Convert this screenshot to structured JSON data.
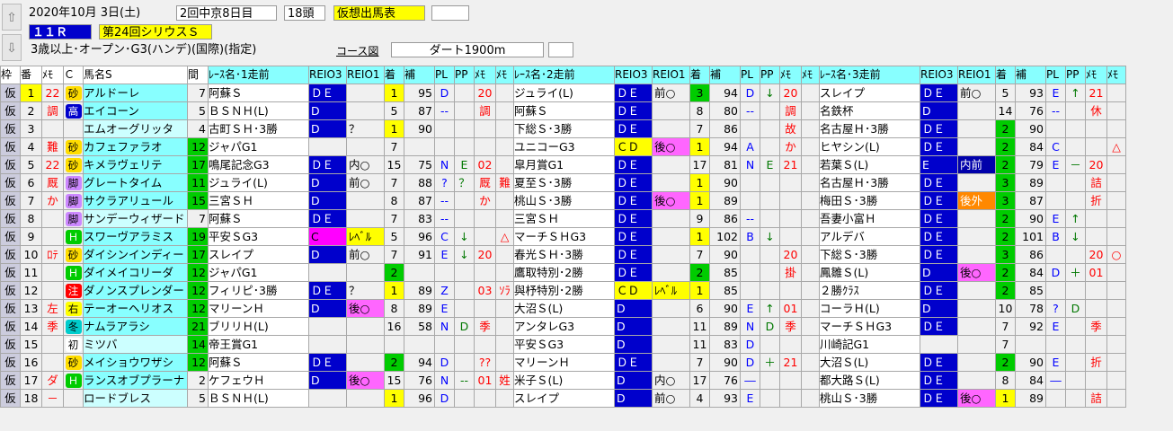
{
  "header": {
    "date": "2020年10月 3日(土)",
    "meet": "2回中京8日目",
    "count": "18頭",
    "status": "仮想出馬表",
    "race_no": "１１Ｒ",
    "race_name": "第24回シリウスＳ",
    "conditions": "3歳以上･オープン･G3(ハンデ)(国際)(指定)",
    "course_label": "コース図",
    "course": "ダート1900m"
  },
  "columns": [
    "枠",
    "番",
    "ﾒﾓ",
    "Ｃ",
    "馬名S",
    "間",
    "ﾚｰｽ名･1走前",
    "REIO3",
    "REIO1",
    "着",
    "補",
    "PL",
    "PP",
    "ﾒﾓ",
    "ﾒﾓ",
    "ﾚｰｽ名･2走前",
    "REIO3",
    "REIO1",
    "着",
    "補",
    "PL",
    "PP",
    "ﾒﾓ",
    "ﾒﾓ",
    "ﾚｰｽ名･3走前",
    "REIO3",
    "REIO1",
    "着",
    "補",
    "PL",
    "PP",
    "ﾒﾓ",
    "ﾒﾓ"
  ],
  "rows": [
    {
      "waku": "仮",
      "ban": "1",
      "memo": "22",
      "c": "砂",
      "name": "アルドーレ",
      "kan": "7",
      "r1": [
        "阿蘇Ｓ",
        "ＤＥ",
        "",
        "1",
        "95",
        "D",
        "",
        "20",
        ""
      ],
      "r2": [
        "ジュライ(L)",
        "ＤＥ",
        "前○",
        "3",
        "94",
        "D",
        "↓",
        "20",
        ""
      ],
      "r3": [
        "スレイプ",
        "ＤＥ",
        "前○",
        "5",
        "93",
        "E",
        "↑",
        "21",
        ""
      ]
    },
    {
      "waku": "仮",
      "ban": "2",
      "memo": "調",
      "c": "高",
      "name": "エイコーン",
      "kan": "5",
      "r1": [
        "ＢＳＮＨ(L)",
        "D",
        "",
        "5",
        "87",
        "--",
        "",
        "調",
        ""
      ],
      "r2": [
        "阿蘇Ｓ",
        "ＤＥ",
        "",
        "8",
        "80",
        "--",
        "",
        "調",
        ""
      ],
      "r3": [
        "名鉄杯",
        "D",
        "",
        "14",
        "76",
        "--",
        "",
        "休",
        ""
      ]
    },
    {
      "waku": "仮",
      "ban": "3",
      "memo": "",
      "c": "",
      "name": "エムオーグリッタ",
      "kan": "4",
      "r1": [
        "古町ＳＨ･3勝",
        "D",
        "？",
        "1",
        "90",
        "",
        "",
        "",
        ""
      ],
      "r2": [
        "下総Ｓ･3勝",
        "ＤＥ",
        "",
        "7",
        "86",
        "",
        "",
        "故",
        ""
      ],
      "r3": [
        "名古屋Ｈ･3勝",
        "ＤＥ",
        "",
        "2",
        "90",
        "",
        "",
        "",
        ""
      ]
    },
    {
      "waku": "仮",
      "ban": "4",
      "memo": "難",
      "c": "砂",
      "name": "カフェファラオ",
      "kan": "12",
      "r1": [
        "ジャパG1",
        "",
        "",
        "7",
        "",
        "",
        "",
        "",
        ""
      ],
      "r2": [
        "ユニコーG3",
        "ＣＤ",
        "後○",
        "1",
        "94",
        "A",
        "",
        "か",
        ""
      ],
      "r3": [
        "ヒヤシン(L)",
        "ＤＥ",
        "",
        "2",
        "84",
        "C",
        "",
        "",
        "△"
      ]
    },
    {
      "waku": "仮",
      "ban": "5",
      "memo": "22",
      "c": "砂",
      "name": "キメラヴェリテ",
      "kan": "17",
      "r1": [
        "鳴尾記念G3",
        "ＤＥ",
        "内○",
        "15",
        "75",
        "N",
        "E",
        "02",
        ""
      ],
      "r2": [
        "皐月賞G1",
        "ＤＥ",
        "",
        "17",
        "81",
        "N",
        "E",
        "21",
        ""
      ],
      "r3": [
        "若葉Ｓ(L)",
        "E",
        "内前",
        "2",
        "79",
        "E",
        "－",
        "20",
        ""
      ]
    },
    {
      "waku": "仮",
      "ban": "6",
      "memo": "厩",
      "c": "脚",
      "name": "グレートタイム",
      "kan": "11",
      "r1": [
        "ジュライ(L)",
        "D",
        "前○",
        "7",
        "88",
        "?",
        "？",
        "厩",
        "難"
      ],
      "r2": [
        "夏至Ｓ･3勝",
        "ＤＥ",
        "",
        "1",
        "90",
        "",
        "",
        "",
        ""
      ],
      "r3": [
        "名古屋Ｈ･3勝",
        "ＤＥ",
        "",
        "3",
        "89",
        "",
        "",
        "詰",
        ""
      ]
    },
    {
      "waku": "仮",
      "ban": "7",
      "memo": "か",
      "c": "脚",
      "name": "サクラアリュール",
      "kan": "15",
      "r1": [
        "三宮ＳＨ",
        "D",
        "",
        "8",
        "87",
        "--",
        "",
        "か",
        ""
      ],
      "r2": [
        "桃山Ｓ･3勝",
        "ＤＥ",
        "後○",
        "1",
        "89",
        "",
        "",
        "",
        ""
      ],
      "r3": [
        "梅田Ｓ･3勝",
        "ＤＥ",
        "後外",
        "3",
        "87",
        "",
        "",
        "折",
        ""
      ]
    },
    {
      "waku": "仮",
      "ban": "8",
      "memo": "",
      "c": "脚",
      "name": "サンデーウィザード",
      "kan": "7",
      "r1": [
        "阿蘇Ｓ",
        "ＤＥ",
        "",
        "7",
        "83",
        "--",
        "",
        "",
        ""
      ],
      "r2": [
        "三宮ＳＨ",
        "ＤＥ",
        "",
        "9",
        "86",
        "--",
        "",
        "",
        ""
      ],
      "r3": [
        "吾妻小富Ｈ",
        "ＤＥ",
        "",
        "2",
        "90",
        "E",
        "↑",
        "",
        ""
      ]
    },
    {
      "waku": "仮",
      "ban": "9",
      "memo": "",
      "c": "Ｈ",
      "name": "スワーヴアラミス",
      "kan": "19",
      "r1": [
        "平安ＳG3",
        "C",
        "ﾚﾍﾞﾙ",
        "5",
        "96",
        "C",
        "↓",
        "",
        "△"
      ],
      "r2": [
        "マーチＳＨG3",
        "ＤＥ",
        "",
        "1",
        "102",
        "B",
        "↓",
        "",
        ""
      ],
      "r3": [
        "アルデバ",
        "ＤＥ",
        "",
        "2",
        "101",
        "B",
        "↓",
        "",
        ""
      ]
    },
    {
      "waku": "仮",
      "ban": "10",
      "memo": "ﾛﾃ",
      "c": "砂",
      "name": "ダイシンインディー",
      "kan": "17",
      "r1": [
        "スレイプ",
        "D",
        "前○",
        "7",
        "91",
        "E",
        "↓",
        "20",
        ""
      ],
      "r2": [
        "春光ＳＨ･3勝",
        "ＤＥ",
        "",
        "7",
        "90",
        "",
        "",
        "20",
        ""
      ],
      "r3": [
        "下総Ｓ･3勝",
        "ＤＥ",
        "",
        "3",
        "86",
        "",
        "",
        "20",
        "○"
      ]
    },
    {
      "waku": "仮",
      "ban": "11",
      "memo": "",
      "c": "Ｈ",
      "name": "ダイメイコリーダ",
      "kan": "12",
      "r1": [
        "ジャパG1",
        "",
        "",
        "2",
        "",
        "",
        "",
        "",
        ""
      ],
      "r2": [
        "鷹取特別･2勝",
        "ＤＥ",
        "",
        "2",
        "85",
        "",
        "",
        "掛",
        ""
      ],
      "r3": [
        "鳳雛Ｓ(L)",
        "D",
        "後○",
        "2",
        "84",
        "D",
        "＋",
        "01",
        ""
      ]
    },
    {
      "waku": "仮",
      "ban": "12",
      "memo": "",
      "c": "注",
      "name": "ダノンスプレンダー",
      "kan": "12",
      "r1": [
        "フィリピ･3勝",
        "ＤＥ",
        "？",
        "1",
        "89",
        "Z",
        "",
        "03",
        "ｿﾗ"
      ],
      "r2": [
        "與杼特別･2勝",
        "ＣＤ",
        "ﾚﾍﾞﾙ",
        "1",
        "85",
        "",
        "",
        "",
        ""
      ],
      "r3": [
        "２勝ｸﾗｽ",
        "ＤＥ",
        "",
        "2",
        "85",
        "",
        "",
        "",
        ""
      ]
    },
    {
      "waku": "仮",
      "ban": "13",
      "memo": "左",
      "c": "右",
      "name": "テーオーヘリオス",
      "kan": "12",
      "r1": [
        "マリーンＨ",
        "D",
        "後○",
        "8",
        "89",
        "E",
        "",
        "",
        ""
      ],
      "r2": [
        "大沼Ｓ(L)",
        "D",
        "",
        "6",
        "90",
        "E",
        "↑",
        "01",
        ""
      ],
      "r3": [
        "コーラＨ(L)",
        "D",
        "",
        "10",
        "78",
        "?",
        "D",
        ""
      ]
    },
    {
      "waku": "仮",
      "ban": "14",
      "memo": "季",
      "c": "冬",
      "name": "ナムラアラシ",
      "kan": "21",
      "r1": [
        "ブリリＨ(L)",
        "",
        "",
        "16",
        "58",
        "N",
        "D",
        "季",
        ""
      ],
      "r2": [
        "アンタレG3",
        "D",
        "",
        "11",
        "89",
        "N",
        "D",
        "季",
        ""
      ],
      "r3": [
        "マーチＳＨG3",
        "ＤＥ",
        "",
        "7",
        "92",
        "E",
        "",
        "季",
        ""
      ]
    },
    {
      "waku": "仮",
      "ban": "15",
      "memo": "",
      "c": "初",
      "name": "ミツバ",
      "kan": "14",
      "r1": [
        "帝王賞G1",
        "",
        "",
        "",
        "",
        "",
        "",
        "",
        ""
      ],
      "r2": [
        "平安ＳG3",
        "D",
        "",
        "11",
        "83",
        "D",
        "",
        "",
        ""
      ],
      "r3": [
        "川崎記G1",
        "",
        "",
        "7",
        "",
        "",
        "",
        "",
        ""
      ]
    },
    {
      "waku": "仮",
      "ban": "16",
      "memo": "",
      "c": "砂",
      "name": "メイショウワザシ",
      "kan": "12",
      "r1": [
        "阿蘇Ｓ",
        "ＤＥ",
        "",
        "2",
        "94",
        "D",
        "",
        "??",
        ""
      ],
      "r2": [
        "マリーンＨ",
        "ＤＥ",
        "",
        "7",
        "90",
        "D",
        "＋",
        "21",
        ""
      ],
      "r3": [
        "大沼Ｓ(L)",
        "ＤＥ",
        "",
        "2",
        "90",
        "E",
        "",
        "折",
        ""
      ]
    },
    {
      "waku": "仮",
      "ban": "17",
      "memo": "ダ",
      "c": "Ｈ",
      "name": "ランスオブプラーナ",
      "kan": "2",
      "r1": [
        "ケフェウＨ",
        "D",
        "後○",
        "15",
        "76",
        "N",
        "--",
        "01",
        "姓"
      ],
      "r2": [
        "米子Ｓ(L)",
        "D",
        "内○",
        "17",
        "76",
        "―",
        "",
        "",
        ""
      ],
      "r3": [
        "都大路Ｓ(L)",
        "ＤＥ",
        "",
        "8",
        "84",
        "―",
        "",
        "",
        ""
      ]
    },
    {
      "waku": "仮",
      "ban": "18",
      "memo": "－",
      "c": "",
      "name": "ロードブレス",
      "kan": "5",
      "r1": [
        "ＢＳＮＨ(L)",
        "",
        "",
        "1",
        "96",
        "D",
        "",
        "",
        ""
      ],
      "r2": [
        "スレイプ",
        "D",
        "前○",
        "4",
        "93",
        "E",
        "",
        "",
        ""
      ],
      "r3": [
        "桃山Ｓ･3勝",
        "ＤＥ",
        "後○",
        "1",
        "89",
        "",
        "",
        "詰",
        ""
      ]
    }
  ],
  "colors": {
    "dark_blue": "#0000cc",
    "yellow": "#ffff00",
    "cyan": "#88ffff",
    "green": "#00cc00",
    "pink": "#ff66ff",
    "orange": "#ff8800"
  }
}
